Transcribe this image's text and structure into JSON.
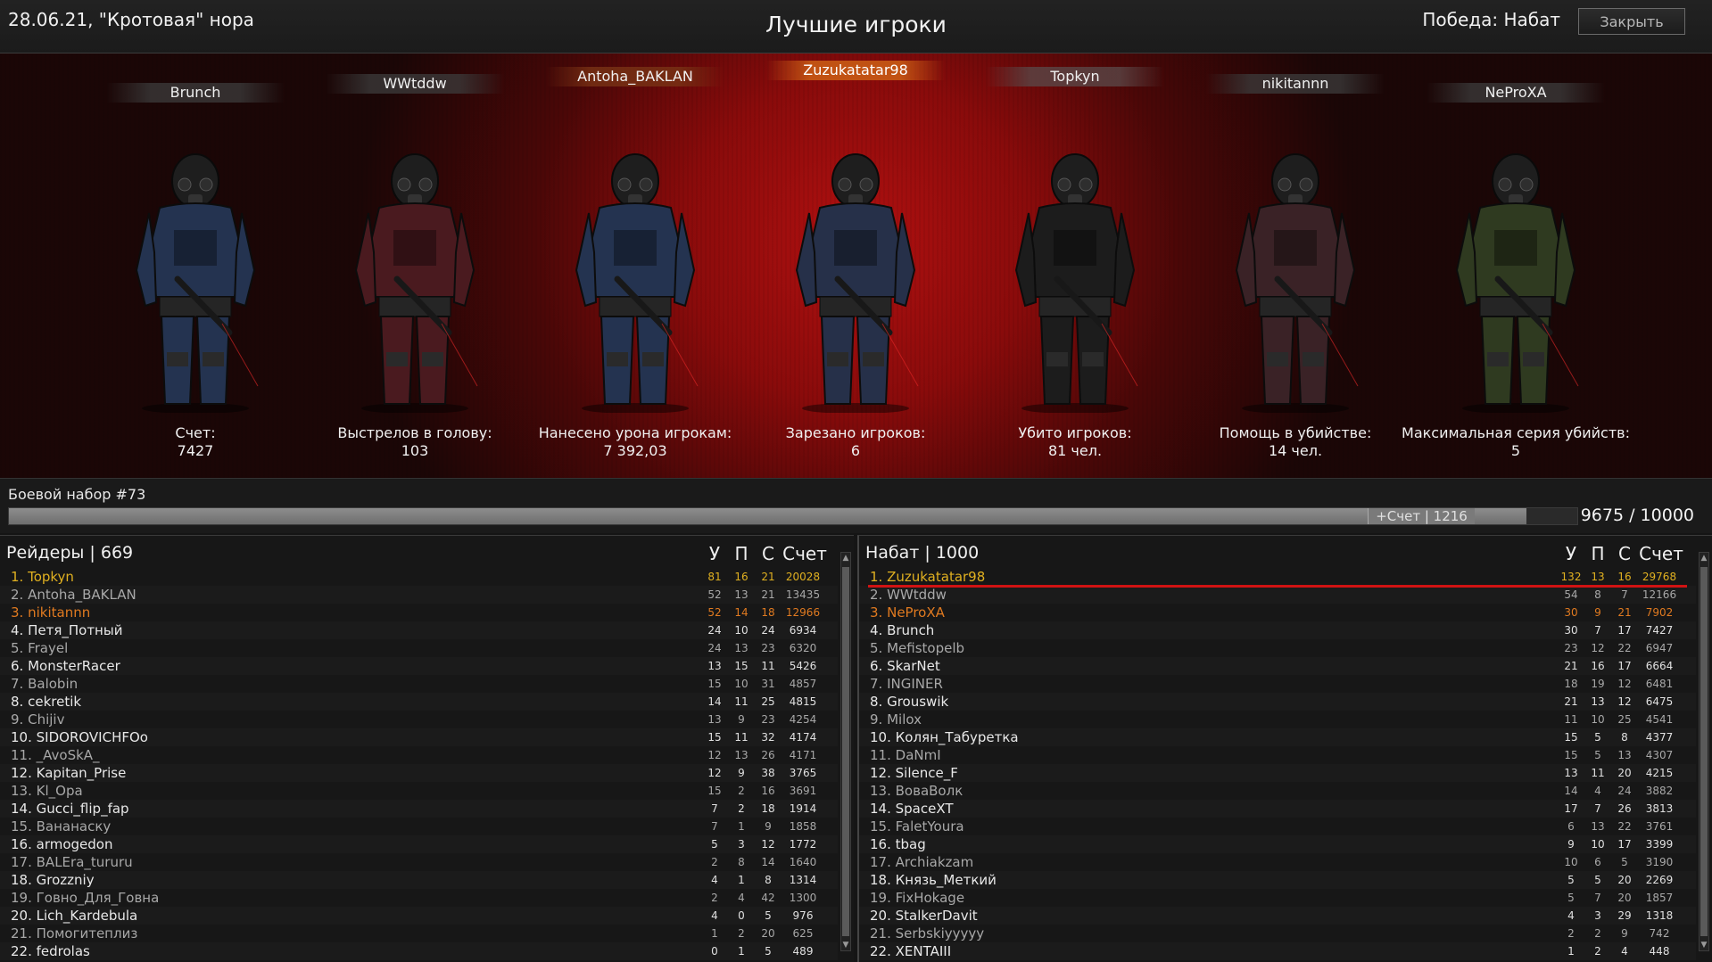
{
  "header": {
    "date_location": "28.06.21, \"Кротовая\" нора",
    "title": "Лучшие игроки",
    "victory": "Победа: Набат",
    "close_label": "Закрыть"
  },
  "podium": [
    {
      "name": "Brunch",
      "stat_label": "Счет:",
      "stat_value": "7427",
      "armor": "#243350",
      "highlight": ""
    },
    {
      "name": "WWtddw",
      "stat_label": "Выстрелов в голову:",
      "stat_value": "103",
      "armor": "#4a1a1f",
      "highlight": ""
    },
    {
      "name": "Antoha_BAKLAN",
      "stat_label": "Нанесено урона игрокам:",
      "stat_value": "7 392,03",
      "armor": "#243350",
      "highlight": "rank2"
    },
    {
      "name": "Zuzukatatar98",
      "stat_label": "Зарезано игроков:",
      "stat_value": "6",
      "armor": "#263049",
      "highlight": "rank1"
    },
    {
      "name": "Topkyn",
      "stat_label": "Убито игроков:",
      "stat_value": "81 чел.",
      "armor": "#1c1c1c",
      "highlight": "rank3"
    },
    {
      "name": "nikitannn",
      "stat_label": "Помощь в убийстве:",
      "stat_value": "14 чел.",
      "armor": "#3a2226",
      "highlight": ""
    },
    {
      "name": "NeProXA",
      "stat_label": "Максимальная серия убийств:",
      "stat_value": "5",
      "armor": "#2f3a20",
      "highlight": ""
    }
  ],
  "kit": {
    "label": "Боевой набор #73",
    "bonus": "+Счет | 1216",
    "total": "9675 / 10000",
    "progress": 0.9675,
    "bonus_fraction": 0.1216
  },
  "columns": [
    "У",
    "П",
    "С",
    "Счет"
  ],
  "team_left": {
    "title": "Рейдеры | 669",
    "players": [
      {
        "rank": "1.",
        "name": "Topkyn",
        "k": "81",
        "a": "16",
        "d": "21",
        "score": "20028",
        "style": "gold"
      },
      {
        "rank": "2.",
        "name": "Antoha_BAKLAN",
        "k": "52",
        "a": "13",
        "d": "21",
        "score": "13435",
        "style": "dim"
      },
      {
        "rank": "3.",
        "name": "nikitannn",
        "k": "52",
        "a": "14",
        "d": "18",
        "score": "12966",
        "style": "orange"
      },
      {
        "rank": "4.",
        "name": "Петя_Потный",
        "k": "24",
        "a": "10",
        "d": "24",
        "score": "6934",
        "style": ""
      },
      {
        "rank": "5.",
        "name": "Frayel",
        "k": "24",
        "a": "13",
        "d": "23",
        "score": "6320",
        "style": "dim"
      },
      {
        "rank": "6.",
        "name": "MonsterRacer",
        "k": "13",
        "a": "15",
        "d": "11",
        "score": "5426",
        "style": ""
      },
      {
        "rank": "7.",
        "name": "Balobin",
        "k": "15",
        "a": "10",
        "d": "31",
        "score": "4857",
        "style": "dim"
      },
      {
        "rank": "8.",
        "name": "cekretik",
        "k": "14",
        "a": "11",
        "d": "25",
        "score": "4815",
        "style": ""
      },
      {
        "rank": "9.",
        "name": "Chijiv",
        "k": "13",
        "a": "9",
        "d": "23",
        "score": "4254",
        "style": "dim"
      },
      {
        "rank": "10.",
        "name": "SIDOROVICHFOo",
        "k": "15",
        "a": "11",
        "d": "32",
        "score": "4174",
        "style": ""
      },
      {
        "rank": "11.",
        "name": "_AvoSkA_",
        "k": "12",
        "a": "13",
        "d": "26",
        "score": "4171",
        "style": "dim"
      },
      {
        "rank": "12.",
        "name": "Kapitan_Prise",
        "k": "12",
        "a": "9",
        "d": "38",
        "score": "3765",
        "style": ""
      },
      {
        "rank": "13.",
        "name": "Kl_Opa",
        "k": "15",
        "a": "2",
        "d": "16",
        "score": "3691",
        "style": "dim"
      },
      {
        "rank": "14.",
        "name": "Gucci_flip_fap",
        "k": "7",
        "a": "2",
        "d": "18",
        "score": "1914",
        "style": ""
      },
      {
        "rank": "15.",
        "name": "Вананаску",
        "k": "7",
        "a": "1",
        "d": "9",
        "score": "1858",
        "style": "dim"
      },
      {
        "rank": "16.",
        "name": "armogedon",
        "k": "5",
        "a": "3",
        "d": "12",
        "score": "1772",
        "style": ""
      },
      {
        "rank": "17.",
        "name": "BALEra_tururu",
        "k": "2",
        "a": "8",
        "d": "14",
        "score": "1640",
        "style": "dim"
      },
      {
        "rank": "18.",
        "name": "Grozzniy",
        "k": "4",
        "a": "1",
        "d": "8",
        "score": "1314",
        "style": ""
      },
      {
        "rank": "19.",
        "name": "Говно_Для_Говна",
        "k": "2",
        "a": "4",
        "d": "42",
        "score": "1300",
        "style": "dim"
      },
      {
        "rank": "20.",
        "name": "Lich_Kardebula",
        "k": "4",
        "a": "0",
        "d": "5",
        "score": "976",
        "style": ""
      },
      {
        "rank": "21.",
        "name": "Помогитеплиз",
        "k": "1",
        "a": "2",
        "d": "20",
        "score": "625",
        "style": "dim"
      },
      {
        "rank": "22.",
        "name": "fedrolas",
        "k": "0",
        "a": "1",
        "d": "5",
        "score": "489",
        "style": ""
      }
    ]
  },
  "team_right": {
    "title": "Набат | 1000",
    "players": [
      {
        "rank": "1.",
        "name": "Zuzukatatar98",
        "k": "132",
        "a": "13",
        "d": "16",
        "score": "29768",
        "style": "gold"
      },
      {
        "rank": "2.",
        "name": "WWtddw",
        "k": "54",
        "a": "8",
        "d": "7",
        "score": "12166",
        "style": "dim"
      },
      {
        "rank": "3.",
        "name": "NeProXA",
        "k": "30",
        "a": "9",
        "d": "21",
        "score": "7902",
        "style": "orange"
      },
      {
        "rank": "4.",
        "name": "Brunch",
        "k": "30",
        "a": "7",
        "d": "17",
        "score": "7427",
        "style": ""
      },
      {
        "rank": "5.",
        "name": "Mefistopelb",
        "k": "23",
        "a": "12",
        "d": "22",
        "score": "6947",
        "style": "dim"
      },
      {
        "rank": "6.",
        "name": "SkarNet",
        "k": "21",
        "a": "16",
        "d": "17",
        "score": "6664",
        "style": ""
      },
      {
        "rank": "7.",
        "name": "INGINER",
        "k": "18",
        "a": "19",
        "d": "12",
        "score": "6481",
        "style": "dim"
      },
      {
        "rank": "8.",
        "name": "Grouswik",
        "k": "21",
        "a": "13",
        "d": "12",
        "score": "6475",
        "style": ""
      },
      {
        "rank": "9.",
        "name": "Milox",
        "k": "11",
        "a": "10",
        "d": "25",
        "score": "4541",
        "style": "dim"
      },
      {
        "rank": "10.",
        "name": "Колян_Табуретка",
        "k": "15",
        "a": "5",
        "d": "8",
        "score": "4377",
        "style": ""
      },
      {
        "rank": "11.",
        "name": "DaNmI",
        "k": "15",
        "a": "5",
        "d": "13",
        "score": "4307",
        "style": "dim"
      },
      {
        "rank": "12.",
        "name": "Silence_F",
        "k": "13",
        "a": "11",
        "d": "20",
        "score": "4215",
        "style": ""
      },
      {
        "rank": "13.",
        "name": "ВоваВолк",
        "k": "14",
        "a": "4",
        "d": "24",
        "score": "3882",
        "style": "dim"
      },
      {
        "rank": "14.",
        "name": "SpaceXT",
        "k": "17",
        "a": "7",
        "d": "26",
        "score": "3813",
        "style": ""
      },
      {
        "rank": "15.",
        "name": "FaletYoura",
        "k": "6",
        "a": "13",
        "d": "22",
        "score": "3761",
        "style": "dim"
      },
      {
        "rank": "16.",
        "name": "tbag",
        "k": "9",
        "a": "10",
        "d": "17",
        "score": "3399",
        "style": ""
      },
      {
        "rank": "17.",
        "name": "Archiakzam",
        "k": "10",
        "a": "6",
        "d": "5",
        "score": "3190",
        "style": "dim"
      },
      {
        "rank": "18.",
        "name": "Князь_Меткий",
        "k": "5",
        "a": "5",
        "d": "20",
        "score": "2269",
        "style": ""
      },
      {
        "rank": "19.",
        "name": "FixHokage",
        "k": "5",
        "a": "7",
        "d": "20",
        "score": "1857",
        "style": "dim"
      },
      {
        "rank": "20.",
        "name": "StalkerDavit",
        "k": "4",
        "a": "3",
        "d": "29",
        "score": "1318",
        "style": ""
      },
      {
        "rank": "21.",
        "name": "Serbskiyyyyy",
        "k": "2",
        "a": "2",
        "d": "9",
        "score": "742",
        "style": "dim"
      },
      {
        "rank": "22.",
        "name": "XENTAIII",
        "k": "1",
        "a": "2",
        "d": "4",
        "score": "448",
        "style": ""
      }
    ]
  },
  "colors": {
    "gold": "#e0b020",
    "orange": "#e07a20",
    "highlight_line": "#d01010",
    "podium_red": "#b01010"
  }
}
